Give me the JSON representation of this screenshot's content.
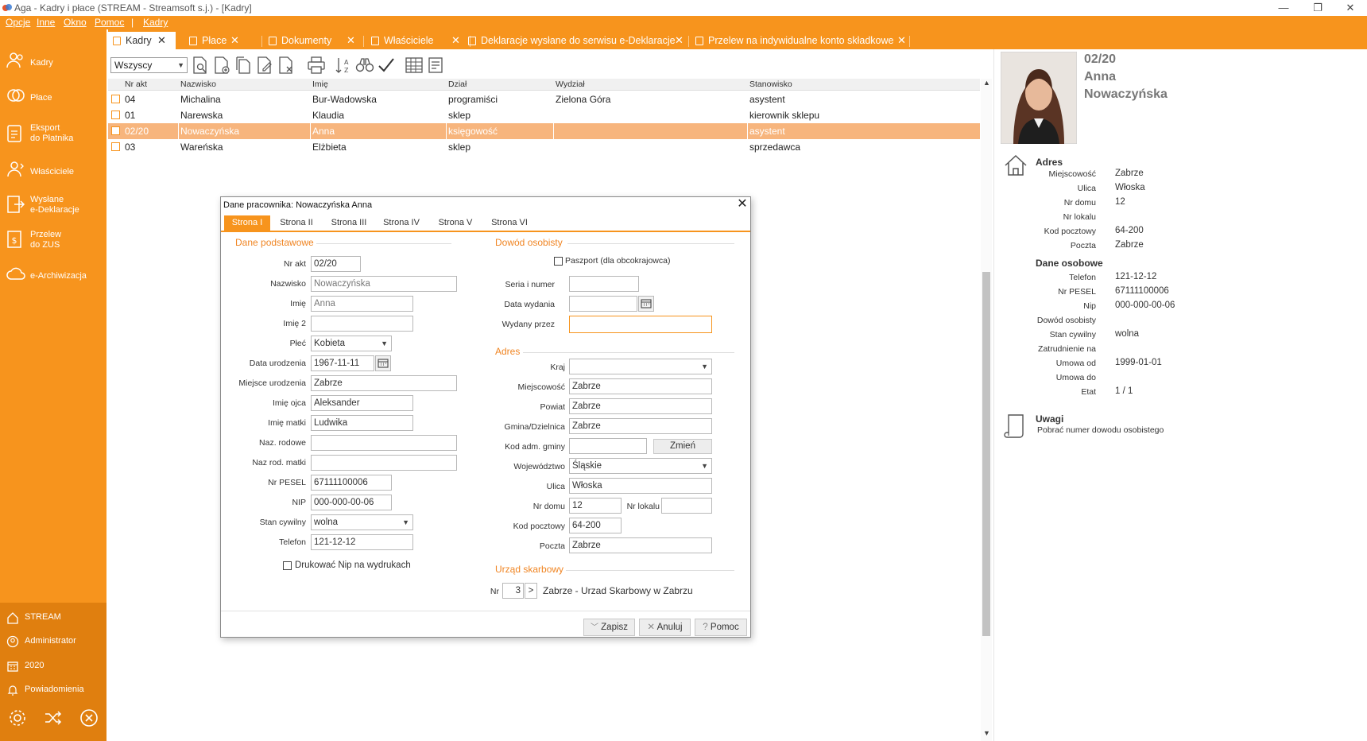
{
  "window": {
    "title": "Aga - Kadry i płace (STREAM - Streamsoft s.j.) - [Kadry]",
    "minimize": "—",
    "restore": "❐",
    "close": "✕"
  },
  "menu": {
    "items": [
      "Opcje",
      "Inne",
      "Okno",
      "Pomoc",
      "Kadry"
    ],
    "separator": "|"
  },
  "tabs": [
    {
      "label": "Kadry",
      "active": true
    },
    {
      "label": "Płace",
      "active": false
    },
    {
      "label": "Dokumenty",
      "active": false
    },
    {
      "label": "Właściciele",
      "active": false
    },
    {
      "label": "Deklaracje wysłane do serwisu e-Deklaracje",
      "active": false
    },
    {
      "label": "Przelew na indywidualne konto składkowe",
      "active": false
    }
  ],
  "tab_close_glyph": "✕",
  "sidebar": {
    "items": [
      {
        "label": "Kadry",
        "icon": "people-icon"
      },
      {
        "label": "Płace",
        "icon": "money-icon"
      },
      {
        "label": "Eksport\ndo Płatnika",
        "icon": "export-icon"
      },
      {
        "label": "Właściciele",
        "icon": "owner-icon"
      },
      {
        "label": "Wysłane\ne-Deklaracje",
        "icon": "send-icon"
      },
      {
        "label": "Przelew\ndo ZUS",
        "icon": "transfer-icon"
      },
      {
        "label": "e-Archiwizacja",
        "icon": "cloud-icon"
      }
    ],
    "bottom": [
      {
        "label": "STREAM",
        "icon": "home-icon"
      },
      {
        "label": "Administrator",
        "icon": "user-icon"
      },
      {
        "label": "2020",
        "icon": "calendar-icon"
      },
      {
        "label": "Powiadomienia",
        "icon": "bell-icon"
      }
    ]
  },
  "toolbar": {
    "filter_value": "Wszyscy"
  },
  "grid": {
    "columns": [
      "Nr akt",
      "Nazwisko",
      "Imię",
      "Dział",
      "Wydział",
      "Stanowisko"
    ],
    "rows": [
      {
        "nr": "04",
        "nazwisko": "Michalina",
        "imie": "Bur-Wadowska",
        "dzial": "programiści",
        "wydzial": "Zielona Góra",
        "stanowisko": "asystent",
        "selected": false
      },
      {
        "nr": "01",
        "nazwisko": "Narewska",
        "imie": "Klaudia",
        "dzial": "sklep",
        "wydzial": "",
        "stanowisko": "kierownik sklepu",
        "selected": false
      },
      {
        "nr": "02/20",
        "nazwisko": "Nowaczyńska",
        "imie": "Anna",
        "dzial": "księgowość",
        "wydzial": "",
        "stanowisko": "asystent",
        "selected": true
      },
      {
        "nr": "03",
        "nazwisko": "Wareńska",
        "imie": "Elżbieta",
        "dzial": "sklep",
        "wydzial": "",
        "stanowisko": "sprzedawca",
        "selected": false
      }
    ]
  },
  "employee_panel": {
    "nr_akt": "02/20",
    "first_name": "Anna",
    "last_name": "Nowaczyńska",
    "address_title": "Adres",
    "address": [
      {
        "label": "Miejscowość",
        "value": "Zabrze"
      },
      {
        "label": "Ulica",
        "value": "Włoska"
      },
      {
        "label": "Nr domu",
        "value": "12"
      },
      {
        "label": "Nr lokalu",
        "value": ""
      },
      {
        "label": "Kod pocztowy",
        "value": "64-200"
      },
      {
        "label": "Poczta",
        "value": "Zabrze"
      }
    ],
    "personal_title": "Dane osobowe",
    "personal": [
      {
        "label": "Telefon",
        "value": "121-12-12"
      },
      {
        "label": "Nr PESEL",
        "value": "67111100006"
      },
      {
        "label": "Nip",
        "value": "000-000-00-06"
      },
      {
        "label": "Dowód osobisty",
        "value": ""
      },
      {
        "label": "Stan cywilny",
        "value": "wolna"
      },
      {
        "label": "Zatrudnienie na",
        "value": ""
      },
      {
        "label": "Umowa od",
        "value": "1999-01-01"
      },
      {
        "label": "Umowa do",
        "value": ""
      },
      {
        "label": "Etat",
        "value": "1 / 1"
      }
    ],
    "notes_title": "Uwagi",
    "notes_text": "Pobrać numer dowodu osobistego"
  },
  "dialog": {
    "title": "Dane pracownika: Nowaczyńska Anna",
    "close": "✕",
    "tabs": [
      "Strona I",
      "Strona II",
      "Strona III",
      "Strona IV",
      "Strona V",
      "Strona VI"
    ],
    "basic_title": "Dane podstawowe",
    "fields": {
      "nr_akt": {
        "label": "Nr akt",
        "value": "02/20"
      },
      "nazwisko": {
        "label": "Nazwisko",
        "value": "Nowaczyńska"
      },
      "imie": {
        "label": "Imię",
        "value": "Anna"
      },
      "imie2": {
        "label": "Imię 2",
        "value": ""
      },
      "plec": {
        "label": "Płeć",
        "value": "Kobieta"
      },
      "data_ur": {
        "label": "Data urodzenia",
        "value": "1967-11-11"
      },
      "miejsce_ur": {
        "label": "Miejsce urodzenia",
        "value": "Zabrze"
      },
      "imie_ojca": {
        "label": "Imię ojca",
        "value": "Aleksander"
      },
      "imie_matki": {
        "label": "Imię matki",
        "value": "Ludwika"
      },
      "naz_rodowe": {
        "label": "Naz. rodowe",
        "value": ""
      },
      "naz_rod_matki": {
        "label": "Naz rod. matki",
        "value": ""
      },
      "pesel": {
        "label": "Nr PESEL",
        "value": "67111100006"
      },
      "nip": {
        "label": "NIP",
        "value": "000-000-00-06"
      },
      "stan_cywilny": {
        "label": "Stan cywilny",
        "value": "wolna"
      },
      "telefon": {
        "label": "Telefon",
        "value": "121-12-12"
      }
    },
    "print_nip_label": "Drukować Nip na wydrukach",
    "id_title": "Dowód osobisty",
    "passport_label": "Paszport (dla obcokrajowca)",
    "id_fields": {
      "seria": {
        "label": "Seria i numer",
        "value": ""
      },
      "data_wydania": {
        "label": "Data wydania",
        "value": ""
      },
      "wydany_przez": {
        "label": "Wydany przez",
        "value": ""
      }
    },
    "address_title": "Adres",
    "addr_fields": {
      "kraj": {
        "label": "Kraj",
        "value": ""
      },
      "miejscowosc": {
        "label": "Miejscowość",
        "value": "Zabrze"
      },
      "powiat": {
        "label": "Powiat",
        "value": "Zabrze"
      },
      "gmina": {
        "label": "Gmina/Dzielnica",
        "value": "Zabrze"
      },
      "kod_gminy": {
        "label": "Kod adm. gminy",
        "value": ""
      },
      "wojewodztwo": {
        "label": "Województwo",
        "value": "Śląskie"
      },
      "ulica": {
        "label": "Ulica",
        "value": "Włoska"
      },
      "nr_domu": {
        "label": "Nr domu",
        "value": "12"
      },
      "nr_lokalu": {
        "label": "Nr lokalu",
        "value": ""
      },
      "kod_pocztowy": {
        "label": "Kod pocztowy",
        "value": "64-200"
      },
      "poczta": {
        "label": "Poczta",
        "value": "Zabrze"
      }
    },
    "change_button": "Zmień",
    "tax_title": "Urząd skarbowy",
    "tax_nr_label": "Nr",
    "tax_nr_value": "3",
    "tax_next": ">",
    "tax_office": "Zabrze - Urzad Skarbowy w Zabrzu",
    "buttons": {
      "save": "Zapisz",
      "cancel": "Anuluj",
      "help": "Pomoc"
    }
  },
  "colors": {
    "accent": "#f7941d",
    "selected_row": "#f7b57d",
    "section_title": "#f08523"
  }
}
